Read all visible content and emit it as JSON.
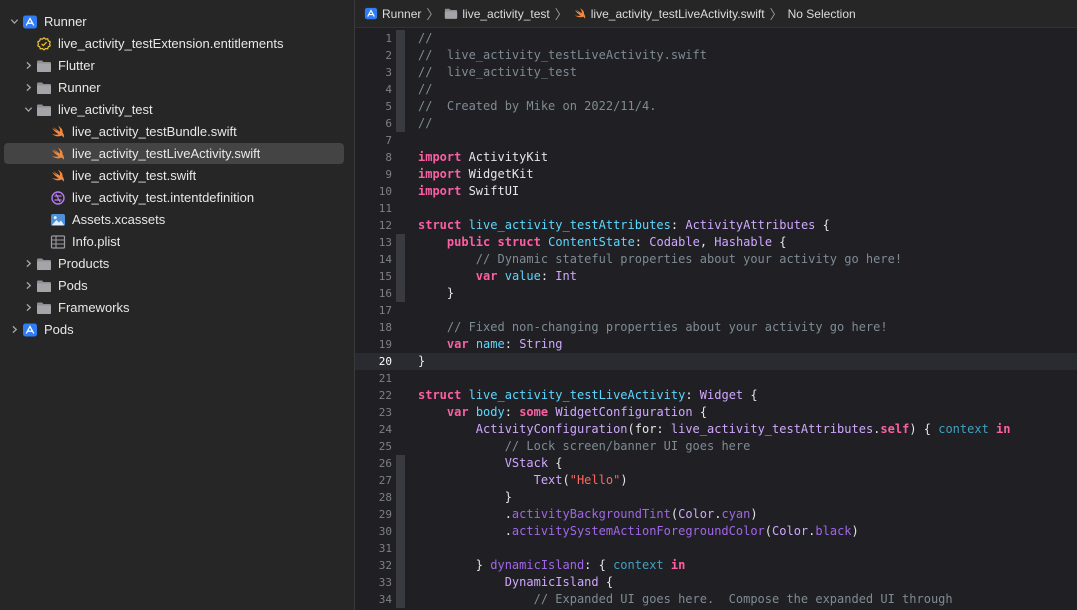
{
  "navigator": {
    "items": [
      {
        "label": "Runner",
        "depth": 0,
        "chevron": "open",
        "icon": "xcode-project-icon"
      },
      {
        "label": "live_activity_testExtension.entitlements",
        "depth": 1,
        "chevron": "none",
        "icon": "entitlements-icon"
      },
      {
        "label": "Flutter",
        "depth": 1,
        "chevron": "closed",
        "icon": "folder-icon"
      },
      {
        "label": "Runner",
        "depth": 1,
        "chevron": "closed",
        "icon": "folder-icon"
      },
      {
        "label": "live_activity_test",
        "depth": 1,
        "chevron": "open",
        "icon": "folder-icon"
      },
      {
        "label": "live_activity_testBundle.swift",
        "depth": 2,
        "chevron": "none",
        "icon": "swift-file-icon"
      },
      {
        "label": "live_activity_testLiveActivity.swift",
        "depth": 2,
        "chevron": "none",
        "icon": "swift-file-icon",
        "selected": true
      },
      {
        "label": "live_activity_test.swift",
        "depth": 2,
        "chevron": "none",
        "icon": "swift-file-icon"
      },
      {
        "label": "live_activity_test.intentdefinition",
        "depth": 2,
        "chevron": "none",
        "icon": "intent-definition-icon"
      },
      {
        "label": "Assets.xcassets",
        "depth": 2,
        "chevron": "none",
        "icon": "assets-catalog-icon"
      },
      {
        "label": "Info.plist",
        "depth": 2,
        "chevron": "none",
        "icon": "plist-table-icon"
      },
      {
        "label": "Products",
        "depth": 1,
        "chevron": "closed",
        "icon": "folder-icon"
      },
      {
        "label": "Pods",
        "depth": 1,
        "chevron": "closed",
        "icon": "folder-icon"
      },
      {
        "label": "Frameworks",
        "depth": 1,
        "chevron": "closed",
        "icon": "folder-icon"
      },
      {
        "label": "Pods",
        "depth": 0,
        "chevron": "closed",
        "icon": "xcode-project-icon"
      }
    ]
  },
  "jumpbar": {
    "crumbs": [
      {
        "label": "Runner",
        "icon": "xcode-project-icon"
      },
      {
        "label": "live_activity_test",
        "icon": "folder-icon"
      },
      {
        "label": "live_activity_testLiveActivity.swift",
        "icon": "swift-file-icon"
      },
      {
        "label": "No Selection",
        "icon": ""
      }
    ]
  },
  "editor": {
    "current_line": 20,
    "lines": [
      {
        "n": "1",
        "fold": true,
        "tokens": [
          [
            "c",
            "//"
          ]
        ]
      },
      {
        "n": "2",
        "fold": true,
        "tokens": [
          [
            "c",
            "//  live_activity_testLiveActivity.swift"
          ]
        ]
      },
      {
        "n": "3",
        "fold": true,
        "tokens": [
          [
            "c",
            "//  live_activity_test"
          ]
        ]
      },
      {
        "n": "4",
        "fold": true,
        "tokens": [
          [
            "c",
            "//"
          ]
        ]
      },
      {
        "n": "5",
        "fold": true,
        "tokens": [
          [
            "c",
            "//  Created by Mike on 2022/11/4."
          ]
        ]
      },
      {
        "n": "6",
        "fold": true,
        "tokens": [
          [
            "c",
            "//"
          ]
        ]
      },
      {
        "n": "7",
        "fold": false,
        "tokens": []
      },
      {
        "n": "8",
        "fold": false,
        "tokens": [
          [
            "k",
            "import"
          ],
          [
            "p",
            " ActivityKit"
          ]
        ]
      },
      {
        "n": "9",
        "fold": false,
        "tokens": [
          [
            "k",
            "import"
          ],
          [
            "p",
            " WidgetKit"
          ]
        ]
      },
      {
        "n": "10",
        "fold": false,
        "tokens": [
          [
            "k",
            "import"
          ],
          [
            "p",
            " SwiftUI"
          ]
        ]
      },
      {
        "n": "11",
        "fold": false,
        "tokens": []
      },
      {
        "n": "12",
        "fold": false,
        "tokens": [
          [
            "k",
            "struct"
          ],
          [
            "p",
            " "
          ],
          [
            "t",
            "live_activity_testAttributes"
          ],
          [
            "p",
            ": "
          ],
          [
            "r",
            "ActivityAttributes"
          ],
          [
            "p",
            " {"
          ]
        ]
      },
      {
        "n": "13",
        "fold": true,
        "tokens": [
          [
            "p",
            "    "
          ],
          [
            "k",
            "public"
          ],
          [
            "p",
            " "
          ],
          [
            "k",
            "struct"
          ],
          [
            "p",
            " "
          ],
          [
            "t",
            "ContentState"
          ],
          [
            "p",
            ": "
          ],
          [
            "r",
            "Codable"
          ],
          [
            "p",
            ", "
          ],
          [
            "r",
            "Hashable"
          ],
          [
            "p",
            " {"
          ]
        ]
      },
      {
        "n": "14",
        "fold": true,
        "tokens": [
          [
            "p",
            "        "
          ],
          [
            "c",
            "// Dynamic stateful properties about your activity go here!"
          ]
        ]
      },
      {
        "n": "15",
        "fold": true,
        "tokens": [
          [
            "p",
            "        "
          ],
          [
            "k",
            "var"
          ],
          [
            "p",
            " "
          ],
          [
            "t",
            "value"
          ],
          [
            "p",
            ": "
          ],
          [
            "r",
            "Int"
          ]
        ]
      },
      {
        "n": "16",
        "fold": true,
        "tokens": [
          [
            "p",
            "    }"
          ]
        ]
      },
      {
        "n": "17",
        "fold": false,
        "tokens": []
      },
      {
        "n": "18",
        "fold": false,
        "tokens": [
          [
            "p",
            "    "
          ],
          [
            "c",
            "// Fixed non-changing properties about your activity go here!"
          ]
        ]
      },
      {
        "n": "19",
        "fold": false,
        "tokens": [
          [
            "p",
            "    "
          ],
          [
            "k",
            "var"
          ],
          [
            "p",
            " "
          ],
          [
            "t",
            "name"
          ],
          [
            "p",
            ": "
          ],
          [
            "r",
            "String"
          ]
        ]
      },
      {
        "n": "20",
        "fold": false,
        "tokens": [
          [
            "p",
            "}"
          ]
        ]
      },
      {
        "n": "21",
        "fold": false,
        "tokens": []
      },
      {
        "n": "22",
        "fold": false,
        "tokens": [
          [
            "k",
            "struct"
          ],
          [
            "p",
            " "
          ],
          [
            "t",
            "live_activity_testLiveActivity"
          ],
          [
            "p",
            ": "
          ],
          [
            "r",
            "Widget"
          ],
          [
            "p",
            " {"
          ]
        ]
      },
      {
        "n": "23",
        "fold": false,
        "tokens": [
          [
            "p",
            "    "
          ],
          [
            "k",
            "var"
          ],
          [
            "p",
            " "
          ],
          [
            "t",
            "body"
          ],
          [
            "p",
            ": "
          ],
          [
            "k",
            "some"
          ],
          [
            "p",
            " "
          ],
          [
            "r",
            "WidgetConfiguration"
          ],
          [
            "p",
            " {"
          ]
        ]
      },
      {
        "n": "24",
        "fold": false,
        "tokens": [
          [
            "p",
            "        "
          ],
          [
            "r",
            "ActivityConfiguration"
          ],
          [
            "p",
            "(for: "
          ],
          [
            "r",
            "live_activity_testAttributes"
          ],
          [
            "p",
            "."
          ],
          [
            "k",
            "self"
          ],
          [
            "p",
            ") { "
          ],
          [
            "x",
            "context"
          ],
          [
            "p",
            " "
          ],
          [
            "k",
            "in"
          ]
        ]
      },
      {
        "n": "25",
        "fold": false,
        "tokens": [
          [
            "p",
            "            "
          ],
          [
            "c",
            "// Lock screen/banner UI goes here"
          ]
        ]
      },
      {
        "n": "26",
        "fold": true,
        "tokens": [
          [
            "p",
            "            "
          ],
          [
            "r",
            "VStack"
          ],
          [
            "p",
            " {"
          ]
        ]
      },
      {
        "n": "27",
        "fold": true,
        "tokens": [
          [
            "p",
            "                "
          ],
          [
            "r",
            "Text"
          ],
          [
            "p",
            "("
          ],
          [
            "s",
            "\"Hello\""
          ],
          [
            "p",
            ")"
          ]
        ]
      },
      {
        "n": "28",
        "fold": true,
        "tokens": [
          [
            "p",
            "            }"
          ]
        ]
      },
      {
        "n": "29",
        "fold": true,
        "tokens": [
          [
            "p",
            "            ."
          ],
          [
            "m",
            "activityBackgroundTint"
          ],
          [
            "p",
            "("
          ],
          [
            "r",
            "Color"
          ],
          [
            "p",
            "."
          ],
          [
            "m",
            "cyan"
          ],
          [
            "p",
            ")"
          ]
        ]
      },
      {
        "n": "30",
        "fold": true,
        "tokens": [
          [
            "p",
            "            ."
          ],
          [
            "m",
            "activitySystemActionForegroundColor"
          ],
          [
            "p",
            "("
          ],
          [
            "r",
            "Color"
          ],
          [
            "p",
            "."
          ],
          [
            "m",
            "black"
          ],
          [
            "p",
            ")"
          ]
        ]
      },
      {
        "n": "31",
        "fold": true,
        "tokens": []
      },
      {
        "n": "32",
        "fold": true,
        "tokens": [
          [
            "p",
            "        } "
          ],
          [
            "m",
            "dynamicIsland"
          ],
          [
            "p",
            ": { "
          ],
          [
            "x",
            "context"
          ],
          [
            "p",
            " "
          ],
          [
            "k",
            "in"
          ]
        ]
      },
      {
        "n": "33",
        "fold": true,
        "tokens": [
          [
            "p",
            "            "
          ],
          [
            "r",
            "DynamicIsland"
          ],
          [
            "p",
            " {"
          ]
        ]
      },
      {
        "n": "34",
        "fold": true,
        "tokens": [
          [
            "p",
            "                "
          ],
          [
            "c",
            "// Expanded UI goes here.  Compose the expanded UI through"
          ]
        ]
      }
    ]
  },
  "colors": {
    "sidebar_bg": "#262626",
    "editor_bg": "#1f1f24",
    "selection": "#444444",
    "keyword": "#fc5fa3",
    "type_decl": "#5dd8ff",
    "type_ref": "#d0a8ff",
    "comment": "#7f8b93",
    "string": "#fc6a5d"
  }
}
